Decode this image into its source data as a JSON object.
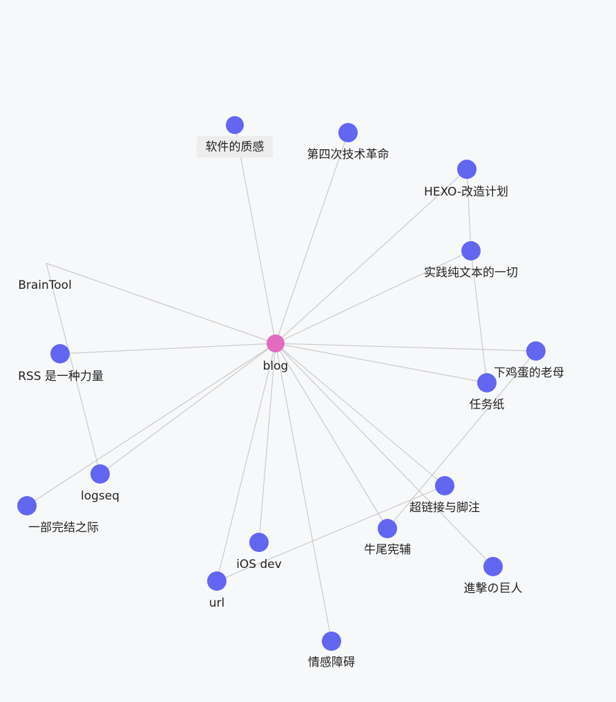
{
  "graph": {
    "colors": {
      "background": "#f7f8fa",
      "edge": "#c9c9c9",
      "node": "#6366f1",
      "center_node": "#e26cc0",
      "label": "#222222",
      "highlight_label_bg": "#ededed"
    },
    "nodes": [
      {
        "id": "blog",
        "label": "blog",
        "center": true
      },
      {
        "id": "software",
        "label": "软件的质感",
        "highlight": true
      },
      {
        "id": "fourth",
        "label": "第四次技术革命"
      },
      {
        "id": "hexo",
        "label": "HEXO-改造计划"
      },
      {
        "id": "plaintext",
        "label": "实践纯文本的一切"
      },
      {
        "id": "braintool",
        "label": "BrainTool"
      },
      {
        "id": "rss",
        "label": "RSS 是一种力量"
      },
      {
        "id": "logseq",
        "label": "logseq"
      },
      {
        "id": "ending",
        "label": "一部完结之际"
      },
      {
        "id": "url",
        "label": "url"
      },
      {
        "id": "ios",
        "label": "iOS dev"
      },
      {
        "id": "emotion",
        "label": "情感障碍"
      },
      {
        "id": "niuwei",
        "label": "牛尾宪辅"
      },
      {
        "id": "hyperlink",
        "label": "超链接与脚注"
      },
      {
        "id": "titan",
        "label": "進撃の巨人"
      },
      {
        "id": "task",
        "label": "任务纸"
      },
      {
        "id": "hen",
        "label": "下鸡蛋的老母"
      }
    ]
  }
}
